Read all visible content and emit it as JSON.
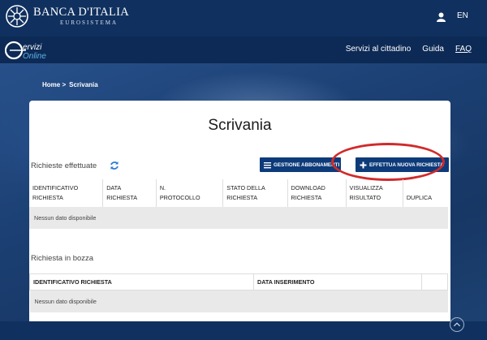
{
  "header": {
    "bank_name": "BANCA D'ITALIA",
    "bank_sub": "EUROSISTEMA",
    "lang": "EN"
  },
  "nav": {
    "logo_text": "Servizi Online",
    "links": [
      "Servizi al cittadino",
      "Guida",
      "FAQ"
    ]
  },
  "breadcrumb": [
    "Home >",
    "Scrivania"
  ],
  "page": {
    "title": "Scrivania",
    "requests_label": "Richieste effettuate",
    "drafts_label": "Richiesta in bozza",
    "btn_gestione": "GESTIONE ABBONAMENTI",
    "btn_nuova": "EFFETTUA NUOVA RICHIESTA"
  },
  "requests_table": {
    "headers": [
      [
        "IDENTIFICATIVO",
        "RICHIESTA"
      ],
      [
        "DATA",
        "RICHIESTA"
      ],
      [
        "N.",
        "PROTOCOLLO"
      ],
      [
        "STATO DELLA",
        "RICHIESTA"
      ],
      [
        "DOWNLOAD",
        "RICHIESTA"
      ],
      [
        "VISUALIZZA",
        "RISULTATO"
      ],
      [
        "",
        "DUPLICA"
      ]
    ],
    "empty": "Nessun dato disponibile"
  },
  "drafts_table": {
    "headers": [
      "IDENTIFICATIVO RICHIESTA",
      "DATA INSERIMENTO",
      ""
    ],
    "empty": "Nessun dato disponibile"
  },
  "colors": {
    "brand_dark": "#10315f",
    "button": "#0d3b7a",
    "highlight": "#d12a2a",
    "refresh": "#2b7bd6"
  }
}
